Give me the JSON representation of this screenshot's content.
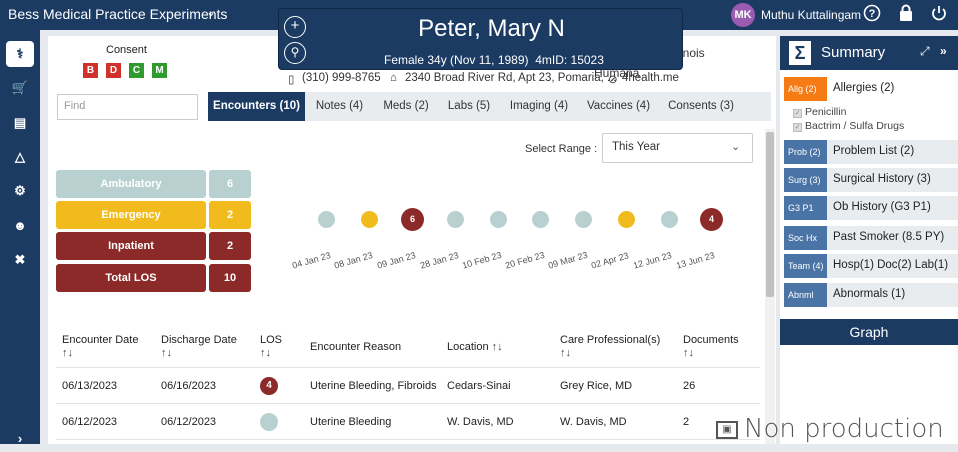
{
  "topbar": {
    "title": "Bess Medical Practice Experiments",
    "user_initials": "MK",
    "user_name": "Muthu Kuttalingam",
    "help_icon": "?",
    "lock_icon": "lock",
    "power_icon": "power"
  },
  "patient": {
    "name": "Peter, Mary N",
    "demographics": "Female 34y (Nov 11, 1989)",
    "mid": "4mID: 15023"
  },
  "consent": {
    "label": "Consent",
    "boxes": [
      "B",
      "D",
      "C",
      "M"
    ]
  },
  "contact": {
    "phone": "(310) 999-8765",
    "address": "2340 Broad River Rd, Apt 23, Pomaria, ...",
    "email": "4health.me",
    "partial_state": "inois",
    "partial_insurer": "Humana"
  },
  "search": {
    "placeholder": "Find"
  },
  "tabs": [
    "Encounters (10)",
    "Notes (4)",
    "Meds (2)",
    "Labs (5)",
    "Imaging (4)",
    "Vaccines (4)",
    "Consents (3)"
  ],
  "range": {
    "label": "Select Range :",
    "value": "This Year"
  },
  "stats": [
    {
      "label": "Ambulatory",
      "value": "6"
    },
    {
      "label": "Emergency",
      "value": "2"
    },
    {
      "label": "Inpatient",
      "value": "2"
    },
    {
      "label": "Total LOS",
      "value": "10"
    }
  ],
  "timeline": {
    "dates": [
      "04 Jan 23",
      "08 Jan 23",
      "09 Jan 23",
      "28 Jan 23",
      "10 Feb 23",
      "20 Feb 23",
      "09 Mar 23",
      "02 Apr 23",
      "12 Jun 23",
      "13 Jun 23"
    ],
    "badges": {
      "09 Jan 23": "6",
      "13 Jun 23": "4"
    }
  },
  "table": {
    "headers": [
      "Encounter Date",
      "Discharge Date",
      "LOS",
      "Encounter Reason",
      "Location",
      "Care Professional(s)",
      "Documents"
    ],
    "rows": [
      {
        "encounter_date": "06/13/2023",
        "discharge_date": "06/16/2023",
        "los": "4",
        "reason": "Uterine Bleeding, Fibroids",
        "location": "Cedars-Sinai",
        "professional": "Grey Rice, MD",
        "documents": "26"
      },
      {
        "encounter_date": "06/12/2023",
        "discharge_date": "06/12/2023",
        "los": "",
        "reason": "Uterine Bleeding",
        "location": "W. Davis, MD",
        "professional": "W. Davis, MD",
        "documents": "2"
      }
    ]
  },
  "summary": {
    "title": "Summary",
    "allergies": {
      "tag": "Allg (2)",
      "text": "Allergies (2)",
      "items": [
        "Penicillin",
        "Bactrim / Sulfa Drugs"
      ]
    },
    "rows": [
      {
        "tag": "Prob (2)",
        "text": "Problem List (2)"
      },
      {
        "tag": "Surg (3)",
        "text": "Surgical History (3)"
      },
      {
        "tag": "G3 P1",
        "text": "Ob History (G3 P1)"
      },
      {
        "tag": "Soc Hx",
        "text": "Past Smoker (8.5 PY)"
      },
      {
        "tag": "Team (4)",
        "text": "Hosp(1) Doc(2) Lab(1)"
      },
      {
        "tag": "Abnml",
        "text": "Abnormals (1)"
      }
    ],
    "graph_label": "Graph"
  },
  "watermark": {
    "text": "Non production"
  },
  "colors": {
    "navy": "#1b3b63",
    "ambulatory": "#b8d1d0",
    "emergency": "#f2bb1d",
    "inpatient": "#8b2a28",
    "allergy": "#f57c14",
    "tag": "#4a74a5"
  }
}
